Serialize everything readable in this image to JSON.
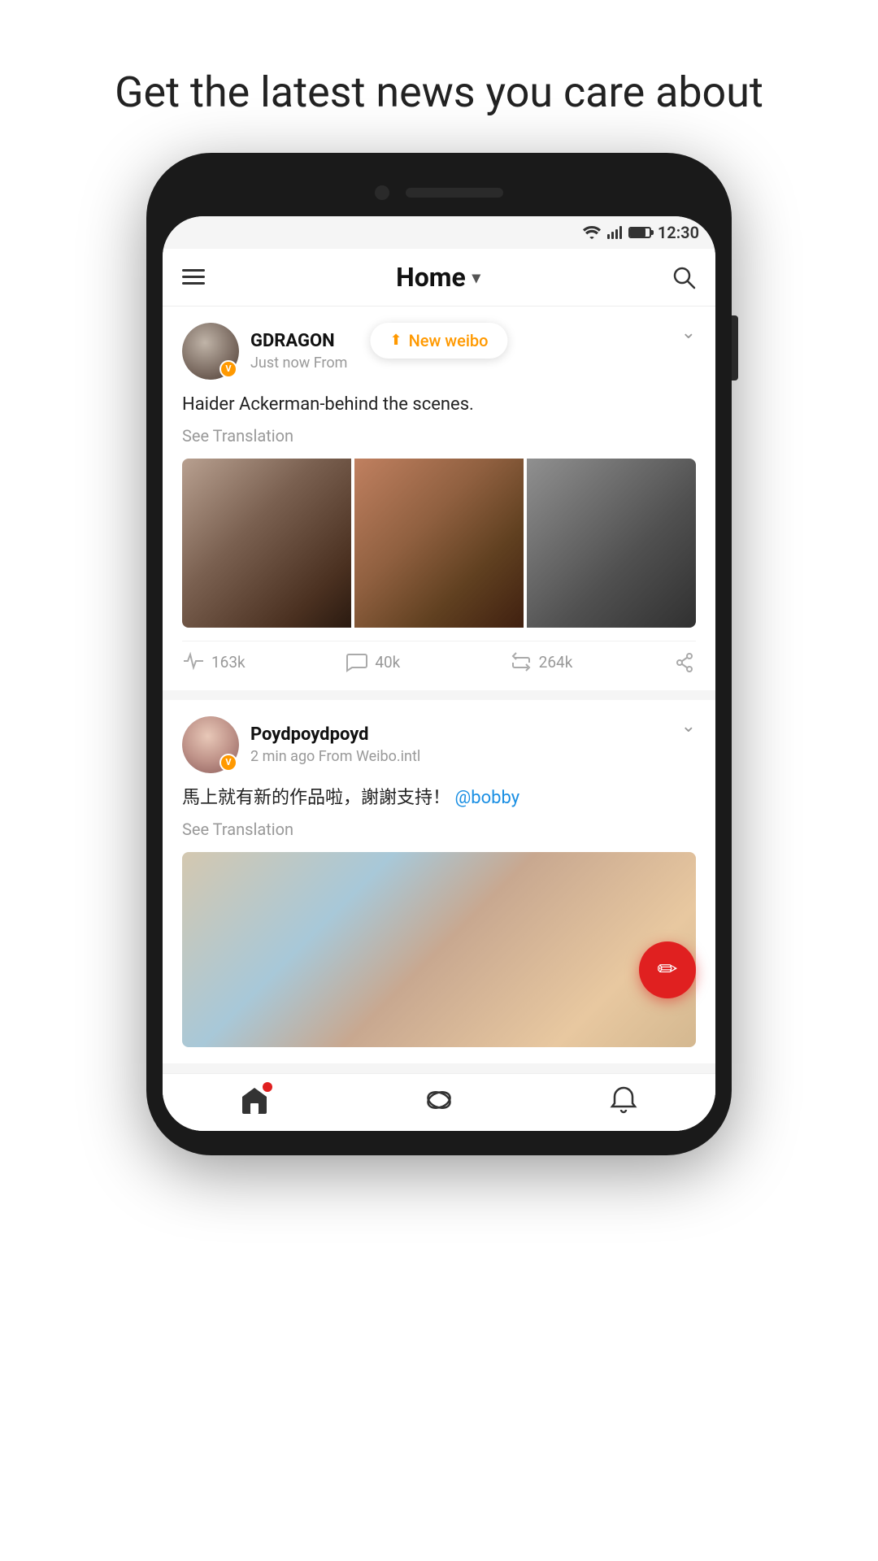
{
  "headline": "Get the latest news you care about",
  "status_bar": {
    "time": "12:30"
  },
  "header": {
    "title": "Home",
    "menu_label": "menu",
    "search_label": "search"
  },
  "new_weibo_toast": {
    "label": "New weibo"
  },
  "posts": [
    {
      "id": "post-1",
      "username": "GDRAGON",
      "time": "Just now",
      "from": "From",
      "source": "",
      "content": "Haider Ackerman-behind the scenes.",
      "see_translation": "See Translation",
      "likes": "163k",
      "comments": "40k",
      "reposts": "264k",
      "has_images": true,
      "image_count": 3
    },
    {
      "id": "post-2",
      "username": "Poydpoydpoyd",
      "time": "2 min ago",
      "from": "From Weibo.intl",
      "source": "Weibo.intl",
      "content": "馬上就有新的作品啦，謝謝支持！",
      "mention": "@bobby",
      "see_translation": "See Translation",
      "has_single_image": true
    }
  ],
  "fab": {
    "label": "compose"
  },
  "bottom_nav": {
    "home": "home",
    "explore": "explore",
    "notifications": "notifications"
  }
}
